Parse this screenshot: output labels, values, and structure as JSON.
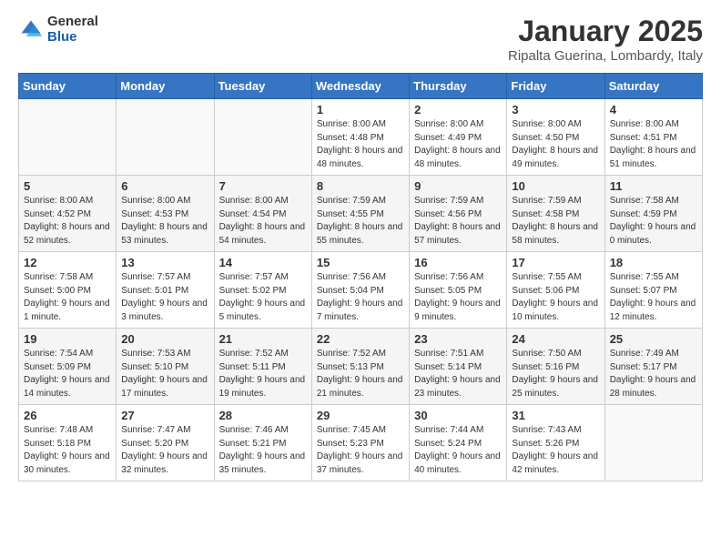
{
  "header": {
    "logo_general": "General",
    "logo_blue": "Blue",
    "title": "January 2025",
    "subtitle": "Ripalta Guerina, Lombardy, Italy"
  },
  "weekdays": [
    "Sunday",
    "Monday",
    "Tuesday",
    "Wednesday",
    "Thursday",
    "Friday",
    "Saturday"
  ],
  "weeks": [
    [
      {
        "day": "",
        "sunrise": "",
        "sunset": "",
        "daylight": ""
      },
      {
        "day": "",
        "sunrise": "",
        "sunset": "",
        "daylight": ""
      },
      {
        "day": "",
        "sunrise": "",
        "sunset": "",
        "daylight": ""
      },
      {
        "day": "1",
        "sunrise": "Sunrise: 8:00 AM",
        "sunset": "Sunset: 4:48 PM",
        "daylight": "Daylight: 8 hours and 48 minutes."
      },
      {
        "day": "2",
        "sunrise": "Sunrise: 8:00 AM",
        "sunset": "Sunset: 4:49 PM",
        "daylight": "Daylight: 8 hours and 48 minutes."
      },
      {
        "day": "3",
        "sunrise": "Sunrise: 8:00 AM",
        "sunset": "Sunset: 4:50 PM",
        "daylight": "Daylight: 8 hours and 49 minutes."
      },
      {
        "day": "4",
        "sunrise": "Sunrise: 8:00 AM",
        "sunset": "Sunset: 4:51 PM",
        "daylight": "Daylight: 8 hours and 51 minutes."
      }
    ],
    [
      {
        "day": "5",
        "sunrise": "Sunrise: 8:00 AM",
        "sunset": "Sunset: 4:52 PM",
        "daylight": "Daylight: 8 hours and 52 minutes."
      },
      {
        "day": "6",
        "sunrise": "Sunrise: 8:00 AM",
        "sunset": "Sunset: 4:53 PM",
        "daylight": "Daylight: 8 hours and 53 minutes."
      },
      {
        "day": "7",
        "sunrise": "Sunrise: 8:00 AM",
        "sunset": "Sunset: 4:54 PM",
        "daylight": "Daylight: 8 hours and 54 minutes."
      },
      {
        "day": "8",
        "sunrise": "Sunrise: 7:59 AM",
        "sunset": "Sunset: 4:55 PM",
        "daylight": "Daylight: 8 hours and 55 minutes."
      },
      {
        "day": "9",
        "sunrise": "Sunrise: 7:59 AM",
        "sunset": "Sunset: 4:56 PM",
        "daylight": "Daylight: 8 hours and 57 minutes."
      },
      {
        "day": "10",
        "sunrise": "Sunrise: 7:59 AM",
        "sunset": "Sunset: 4:58 PM",
        "daylight": "Daylight: 8 hours and 58 minutes."
      },
      {
        "day": "11",
        "sunrise": "Sunrise: 7:58 AM",
        "sunset": "Sunset: 4:59 PM",
        "daylight": "Daylight: 9 hours and 0 minutes."
      }
    ],
    [
      {
        "day": "12",
        "sunrise": "Sunrise: 7:58 AM",
        "sunset": "Sunset: 5:00 PM",
        "daylight": "Daylight: 9 hours and 1 minute."
      },
      {
        "day": "13",
        "sunrise": "Sunrise: 7:57 AM",
        "sunset": "Sunset: 5:01 PM",
        "daylight": "Daylight: 9 hours and 3 minutes."
      },
      {
        "day": "14",
        "sunrise": "Sunrise: 7:57 AM",
        "sunset": "Sunset: 5:02 PM",
        "daylight": "Daylight: 9 hours and 5 minutes."
      },
      {
        "day": "15",
        "sunrise": "Sunrise: 7:56 AM",
        "sunset": "Sunset: 5:04 PM",
        "daylight": "Daylight: 9 hours and 7 minutes."
      },
      {
        "day": "16",
        "sunrise": "Sunrise: 7:56 AM",
        "sunset": "Sunset: 5:05 PM",
        "daylight": "Daylight: 9 hours and 9 minutes."
      },
      {
        "day": "17",
        "sunrise": "Sunrise: 7:55 AM",
        "sunset": "Sunset: 5:06 PM",
        "daylight": "Daylight: 9 hours and 10 minutes."
      },
      {
        "day": "18",
        "sunrise": "Sunrise: 7:55 AM",
        "sunset": "Sunset: 5:07 PM",
        "daylight": "Daylight: 9 hours and 12 minutes."
      }
    ],
    [
      {
        "day": "19",
        "sunrise": "Sunrise: 7:54 AM",
        "sunset": "Sunset: 5:09 PM",
        "daylight": "Daylight: 9 hours and 14 minutes."
      },
      {
        "day": "20",
        "sunrise": "Sunrise: 7:53 AM",
        "sunset": "Sunset: 5:10 PM",
        "daylight": "Daylight: 9 hours and 17 minutes."
      },
      {
        "day": "21",
        "sunrise": "Sunrise: 7:52 AM",
        "sunset": "Sunset: 5:11 PM",
        "daylight": "Daylight: 9 hours and 19 minutes."
      },
      {
        "day": "22",
        "sunrise": "Sunrise: 7:52 AM",
        "sunset": "Sunset: 5:13 PM",
        "daylight": "Daylight: 9 hours and 21 minutes."
      },
      {
        "day": "23",
        "sunrise": "Sunrise: 7:51 AM",
        "sunset": "Sunset: 5:14 PM",
        "daylight": "Daylight: 9 hours and 23 minutes."
      },
      {
        "day": "24",
        "sunrise": "Sunrise: 7:50 AM",
        "sunset": "Sunset: 5:16 PM",
        "daylight": "Daylight: 9 hours and 25 minutes."
      },
      {
        "day": "25",
        "sunrise": "Sunrise: 7:49 AM",
        "sunset": "Sunset: 5:17 PM",
        "daylight": "Daylight: 9 hours and 28 minutes."
      }
    ],
    [
      {
        "day": "26",
        "sunrise": "Sunrise: 7:48 AM",
        "sunset": "Sunset: 5:18 PM",
        "daylight": "Daylight: 9 hours and 30 minutes."
      },
      {
        "day": "27",
        "sunrise": "Sunrise: 7:47 AM",
        "sunset": "Sunset: 5:20 PM",
        "daylight": "Daylight: 9 hours and 32 minutes."
      },
      {
        "day": "28",
        "sunrise": "Sunrise: 7:46 AM",
        "sunset": "Sunset: 5:21 PM",
        "daylight": "Daylight: 9 hours and 35 minutes."
      },
      {
        "day": "29",
        "sunrise": "Sunrise: 7:45 AM",
        "sunset": "Sunset: 5:23 PM",
        "daylight": "Daylight: 9 hours and 37 minutes."
      },
      {
        "day": "30",
        "sunrise": "Sunrise: 7:44 AM",
        "sunset": "Sunset: 5:24 PM",
        "daylight": "Daylight: 9 hours and 40 minutes."
      },
      {
        "day": "31",
        "sunrise": "Sunrise: 7:43 AM",
        "sunset": "Sunset: 5:26 PM",
        "daylight": "Daylight: 9 hours and 42 minutes."
      },
      {
        "day": "",
        "sunrise": "",
        "sunset": "",
        "daylight": ""
      }
    ]
  ]
}
